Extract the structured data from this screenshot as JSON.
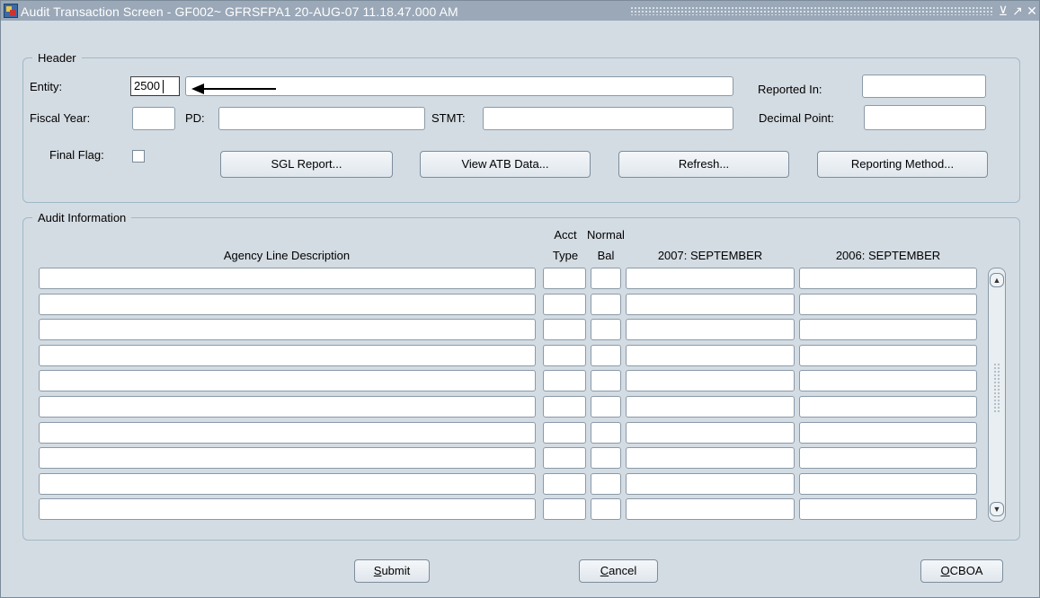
{
  "window": {
    "title": "Audit Transaction Screen - GF002~ GFRSFPA1  20-AUG-07 11.18.47.000 AM",
    "controls": {
      "minimize": "⊻",
      "maximize": "↗",
      "close": "✕"
    }
  },
  "header": {
    "legend": "Header",
    "entity_label": "Entity:",
    "entity_value": "2500",
    "entity_desc_value": "",
    "reported_in_label": "Reported In:",
    "reported_in_value": "",
    "fiscal_year_label": "Fiscal Year:",
    "fiscal_year_value": "",
    "pd_label": "PD:",
    "pd_value": "",
    "stmt_label": "STMT:",
    "stmt_value": "",
    "decimal_point_label": "Decimal Point:",
    "decimal_point_value": "",
    "final_flag_label": "Final Flag:",
    "buttons": {
      "sgl_report": "SGL Report...",
      "view_atb_data": "View ATB Data...",
      "refresh": "Refresh...",
      "reporting_method": "Reporting Method..."
    }
  },
  "audit": {
    "legend": "Audit Information",
    "columns": {
      "description": "Agency Line Description",
      "acct_type_top": "Acct",
      "acct_type_bottom": "Type",
      "normal_bal_top": "Normal",
      "normal_bal_bottom": "Bal",
      "current_year": "2007: SEPTEMBER",
      "prior_year": "2006: SEPTEMBER"
    },
    "row_count": 10
  },
  "footer": {
    "submit_label": "Submit",
    "cancel_label": "Cancel",
    "ocboa_label": "OCBOA"
  },
  "icons": {
    "app": "oracle-forms-app-icon",
    "scroll_up": "scroll-up-icon",
    "scroll_down": "scroll-down-icon",
    "annotation": "annotation-arrow"
  },
  "colors": {
    "window_bg": "#d4dce3",
    "titlebar_bg": "#9aa8b8",
    "group_border": "#9fb9c6"
  }
}
